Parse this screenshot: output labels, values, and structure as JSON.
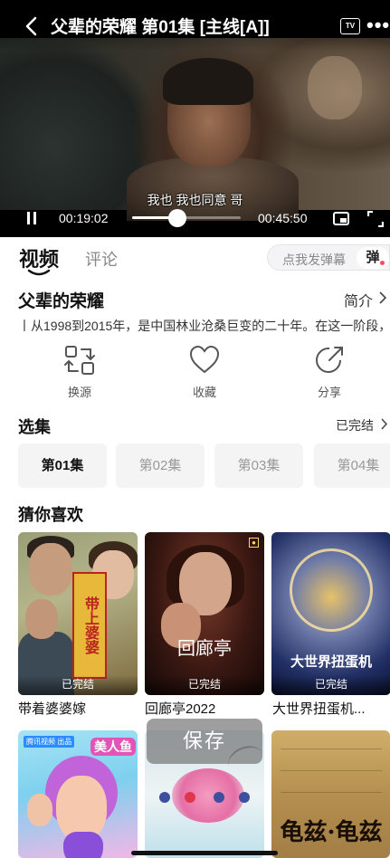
{
  "player": {
    "title": "父辈的荣耀 第01集 [主线[A]]",
    "tv_label": "TV",
    "subtitle": "我也  我也同意  哥",
    "current_time": "00:19:02",
    "total_time": "00:45:50",
    "progress_fraction": 0.415
  },
  "tabs": {
    "video": "视频",
    "comments": "评论"
  },
  "danmaku": {
    "placeholder": "点我发弹幕",
    "toggle_label": "弹"
  },
  "show": {
    "title": "父辈的荣耀",
    "intro_label": "简介",
    "synopsis": "丨从1998到2015年，是中国林业沧桑巨变的二十年。在这一阶段，"
  },
  "actions": [
    {
      "label": "换源",
      "icon": "switch-source-icon"
    },
    {
      "label": "收藏",
      "icon": "heart-icon"
    },
    {
      "label": "分享",
      "icon": "share-icon"
    }
  ],
  "episodes": {
    "section_title": "选集",
    "status": "已完结",
    "items": [
      "第01集",
      "第02集",
      "第03集",
      "第04集"
    ],
    "selected_index": 0
  },
  "recommend": {
    "section_title": "猜你喜欢",
    "items": [
      {
        "name": "带着婆婆嫁",
        "badge": "已完结",
        "poster_text": "带上婆婆"
      },
      {
        "name": "回廊亭2022",
        "badge": "已完结",
        "poster_text": "回廊亭"
      },
      {
        "name": "大世界扭蛋机...",
        "badge": "已完结",
        "poster_text": "大世界扭蛋机"
      },
      {
        "name": "",
        "badge": "",
        "poster_text": "美人鱼",
        "logo_text": "腾讯视频 出品"
      },
      {
        "name": "",
        "badge": "",
        "poster_text": ""
      },
      {
        "name": "",
        "badge": "",
        "poster_text": "龟兹·龟兹"
      }
    ]
  },
  "toast": {
    "label": "保存"
  }
}
